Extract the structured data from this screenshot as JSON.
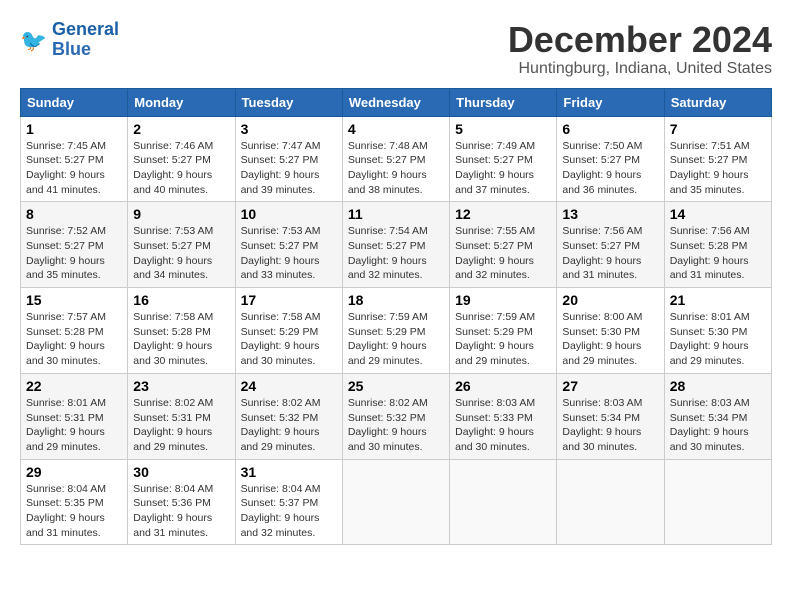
{
  "header": {
    "logo_line1": "General",
    "logo_line2": "Blue",
    "title": "December 2024",
    "subtitle": "Huntingburg, Indiana, United States"
  },
  "columns": [
    "Sunday",
    "Monday",
    "Tuesday",
    "Wednesday",
    "Thursday",
    "Friday",
    "Saturday"
  ],
  "weeks": [
    [
      {
        "day": "1",
        "detail": "Sunrise: 7:45 AM\nSunset: 5:27 PM\nDaylight: 9 hours\nand 41 minutes."
      },
      {
        "day": "2",
        "detail": "Sunrise: 7:46 AM\nSunset: 5:27 PM\nDaylight: 9 hours\nand 40 minutes."
      },
      {
        "day": "3",
        "detail": "Sunrise: 7:47 AM\nSunset: 5:27 PM\nDaylight: 9 hours\nand 39 minutes."
      },
      {
        "day": "4",
        "detail": "Sunrise: 7:48 AM\nSunset: 5:27 PM\nDaylight: 9 hours\nand 38 minutes."
      },
      {
        "day": "5",
        "detail": "Sunrise: 7:49 AM\nSunset: 5:27 PM\nDaylight: 9 hours\nand 37 minutes."
      },
      {
        "day": "6",
        "detail": "Sunrise: 7:50 AM\nSunset: 5:27 PM\nDaylight: 9 hours\nand 36 minutes."
      },
      {
        "day": "7",
        "detail": "Sunrise: 7:51 AM\nSunset: 5:27 PM\nDaylight: 9 hours\nand 35 minutes."
      }
    ],
    [
      {
        "day": "8",
        "detail": "Sunrise: 7:52 AM\nSunset: 5:27 PM\nDaylight: 9 hours\nand 35 minutes."
      },
      {
        "day": "9",
        "detail": "Sunrise: 7:53 AM\nSunset: 5:27 PM\nDaylight: 9 hours\nand 34 minutes."
      },
      {
        "day": "10",
        "detail": "Sunrise: 7:53 AM\nSunset: 5:27 PM\nDaylight: 9 hours\nand 33 minutes."
      },
      {
        "day": "11",
        "detail": "Sunrise: 7:54 AM\nSunset: 5:27 PM\nDaylight: 9 hours\nand 32 minutes."
      },
      {
        "day": "12",
        "detail": "Sunrise: 7:55 AM\nSunset: 5:27 PM\nDaylight: 9 hours\nand 32 minutes."
      },
      {
        "day": "13",
        "detail": "Sunrise: 7:56 AM\nSunset: 5:27 PM\nDaylight: 9 hours\nand 31 minutes."
      },
      {
        "day": "14",
        "detail": "Sunrise: 7:56 AM\nSunset: 5:28 PM\nDaylight: 9 hours\nand 31 minutes."
      }
    ],
    [
      {
        "day": "15",
        "detail": "Sunrise: 7:57 AM\nSunset: 5:28 PM\nDaylight: 9 hours\nand 30 minutes."
      },
      {
        "day": "16",
        "detail": "Sunrise: 7:58 AM\nSunset: 5:28 PM\nDaylight: 9 hours\nand 30 minutes."
      },
      {
        "day": "17",
        "detail": "Sunrise: 7:58 AM\nSunset: 5:29 PM\nDaylight: 9 hours\nand 30 minutes."
      },
      {
        "day": "18",
        "detail": "Sunrise: 7:59 AM\nSunset: 5:29 PM\nDaylight: 9 hours\nand 29 minutes."
      },
      {
        "day": "19",
        "detail": "Sunrise: 7:59 AM\nSunset: 5:29 PM\nDaylight: 9 hours\nand 29 minutes."
      },
      {
        "day": "20",
        "detail": "Sunrise: 8:00 AM\nSunset: 5:30 PM\nDaylight: 9 hours\nand 29 minutes."
      },
      {
        "day": "21",
        "detail": "Sunrise: 8:01 AM\nSunset: 5:30 PM\nDaylight: 9 hours\nand 29 minutes."
      }
    ],
    [
      {
        "day": "22",
        "detail": "Sunrise: 8:01 AM\nSunset: 5:31 PM\nDaylight: 9 hours\nand 29 minutes."
      },
      {
        "day": "23",
        "detail": "Sunrise: 8:02 AM\nSunset: 5:31 PM\nDaylight: 9 hours\nand 29 minutes."
      },
      {
        "day": "24",
        "detail": "Sunrise: 8:02 AM\nSunset: 5:32 PM\nDaylight: 9 hours\nand 29 minutes."
      },
      {
        "day": "25",
        "detail": "Sunrise: 8:02 AM\nSunset: 5:32 PM\nDaylight: 9 hours\nand 30 minutes."
      },
      {
        "day": "26",
        "detail": "Sunrise: 8:03 AM\nSunset: 5:33 PM\nDaylight: 9 hours\nand 30 minutes."
      },
      {
        "day": "27",
        "detail": "Sunrise: 8:03 AM\nSunset: 5:34 PM\nDaylight: 9 hours\nand 30 minutes."
      },
      {
        "day": "28",
        "detail": "Sunrise: 8:03 AM\nSunset: 5:34 PM\nDaylight: 9 hours\nand 30 minutes."
      }
    ],
    [
      {
        "day": "29",
        "detail": "Sunrise: 8:04 AM\nSunset: 5:35 PM\nDaylight: 9 hours\nand 31 minutes."
      },
      {
        "day": "30",
        "detail": "Sunrise: 8:04 AM\nSunset: 5:36 PM\nDaylight: 9 hours\nand 31 minutes."
      },
      {
        "day": "31",
        "detail": "Sunrise: 8:04 AM\nSunset: 5:37 PM\nDaylight: 9 hours\nand 32 minutes."
      },
      {
        "day": "",
        "detail": ""
      },
      {
        "day": "",
        "detail": ""
      },
      {
        "day": "",
        "detail": ""
      },
      {
        "day": "",
        "detail": ""
      }
    ]
  ]
}
